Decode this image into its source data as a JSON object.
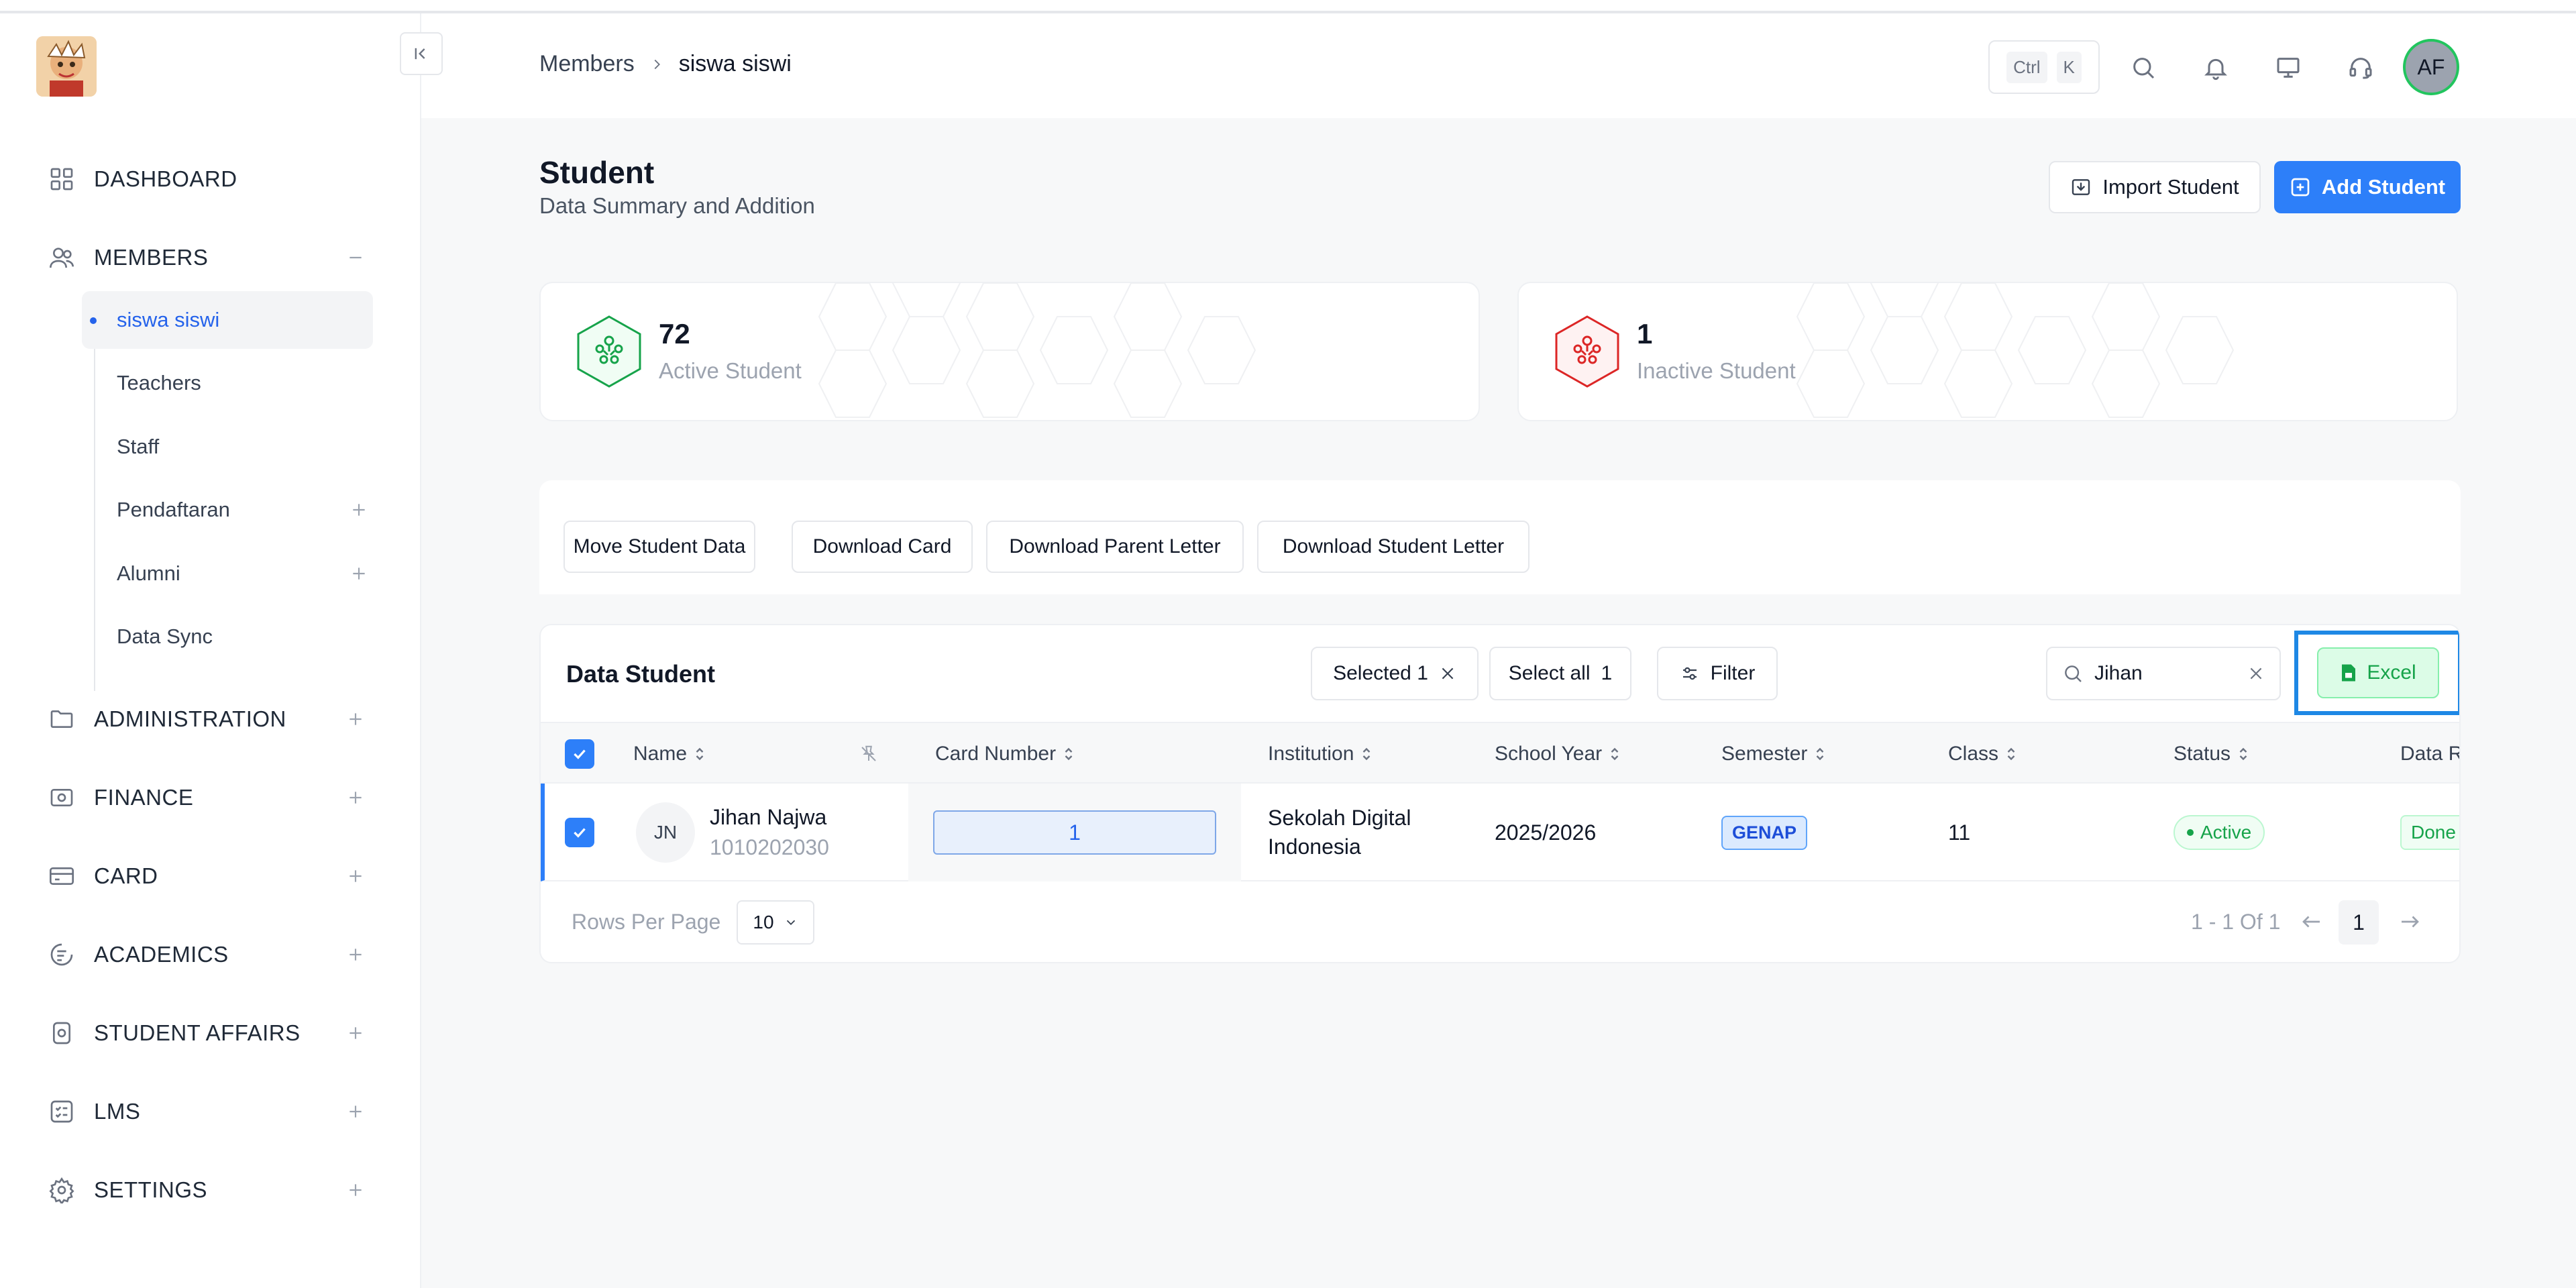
{
  "sidebar": {
    "nav": [
      {
        "label": "DASHBOARD",
        "icon": "grid-icon"
      },
      {
        "label": "MEMBERS",
        "icon": "users-icon",
        "toggle": "minus"
      },
      {
        "label": "ADMINISTRATION",
        "icon": "folder-icon",
        "toggle": "plus"
      },
      {
        "label": "FINANCE",
        "icon": "camera-icon",
        "toggle": "plus"
      },
      {
        "label": "CARD",
        "icon": "card-icon",
        "toggle": "plus"
      },
      {
        "label": "ACADEMICS",
        "icon": "academic-icon",
        "toggle": "plus"
      },
      {
        "label": "STUDENT AFFAIRS",
        "icon": "student-affairs-icon",
        "toggle": "plus"
      },
      {
        "label": "LMS",
        "icon": "lms-icon",
        "toggle": "plus"
      },
      {
        "label": "SETTINGS",
        "icon": "gear-icon",
        "toggle": "plus"
      }
    ],
    "members_sub": [
      {
        "label": "siswa siswi",
        "active": true
      },
      {
        "label": "Teachers"
      },
      {
        "label": "Staff"
      },
      {
        "label": "Pendaftaran",
        "toggle": "plus"
      },
      {
        "label": "Alumni",
        "toggle": "plus"
      },
      {
        "label": "Data Sync"
      }
    ]
  },
  "header": {
    "breadcrumb": [
      "Members",
      "siswa siswi"
    ],
    "shortcut": [
      "Ctrl",
      "K"
    ],
    "avatar_initials": "AF"
  },
  "page": {
    "title": "Student",
    "subtitle": "Data Summary and Addition",
    "import_label": "Import Student",
    "add_label": "Add Student"
  },
  "stats": [
    {
      "value": "72",
      "label": "Active Student",
      "color": "#16a34a"
    },
    {
      "value": "1",
      "label": "Inactive Student",
      "color": "#dc2626"
    }
  ],
  "actions": [
    "Move Student Data",
    "Download Card",
    "Download Parent Letter",
    "Download Student Letter"
  ],
  "table": {
    "title": "Data Student",
    "selected_label": "Selected 1",
    "select_all_label": "Select all",
    "select_all_count": "1",
    "filter_label": "Filter",
    "search_value": "Jihan",
    "excel_label": "Excel",
    "columns": [
      "Name",
      "Card Number",
      "Institution",
      "School Year",
      "Semester",
      "Class",
      "Status",
      "Data R"
    ],
    "rows": [
      {
        "initials": "JN",
        "name": "Jihan Najwa",
        "nis": "1010202030",
        "card_number": "1",
        "institution_line1": "Sekolah Digital",
        "institution_line2": "Indonesia",
        "school_year": "2025/2026",
        "semester": "GENAP",
        "class": "11",
        "status": "Active",
        "data_r": "Done"
      }
    ],
    "rows_per_page_label": "Rows Per Page",
    "rows_per_page": "10",
    "range": "1 - 1 Of 1",
    "current_page": "1"
  },
  "colors": {
    "accent": "#2d7ff9",
    "excel_highlight": "#1e88e5",
    "success": "#16a34a",
    "danger": "#dc2626"
  }
}
